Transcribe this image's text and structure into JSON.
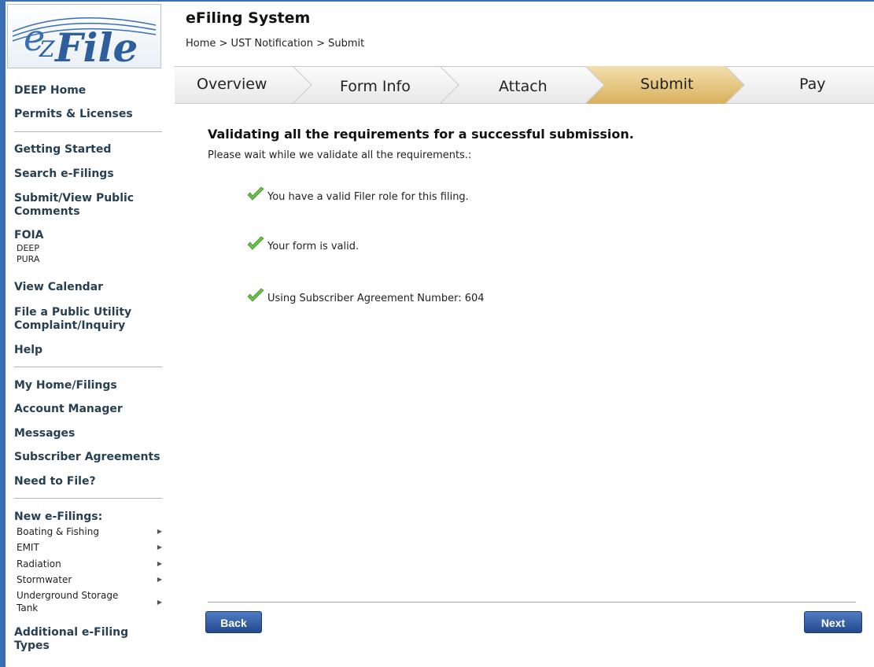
{
  "logo": {
    "text": "eZFile"
  },
  "header": {
    "title": "eFiling System",
    "breadcrumb": "Home > UST Notification > Submit"
  },
  "steps": [
    {
      "label": "Overview",
      "active": false
    },
    {
      "label": "Form Info",
      "active": false
    },
    {
      "label": "Attach",
      "active": false
    },
    {
      "label": "Submit",
      "active": true
    },
    {
      "label": "Pay",
      "active": false
    }
  ],
  "sidebar": {
    "deep_home": "DEEP Home",
    "permits": "Permits & Licenses",
    "getting_started": "Getting Started",
    "search": "Search e-Filings",
    "submit_view_1": "Submit/View Public",
    "submit_view_2": "Comments",
    "foia": "FOIA",
    "foia_deep": "DEEP",
    "foia_pura": "PURA",
    "view_calendar": "View Calendar",
    "file_complaint_1": "File a Public Utility",
    "file_complaint_2": "Complaint/Inquiry",
    "help": "Help",
    "my_home": "My Home/Filings",
    "account_manager": "Account Manager",
    "messages": "Messages",
    "subscriber_agreements": "Subscriber Agreements",
    "need_to_file": "Need to File?",
    "new_efilings": "New e-Filings:",
    "new_items": [
      "Boating & Fishing",
      "EMIT",
      "Radiation",
      "Stormwater",
      "Underground Storage",
      "Tank"
    ],
    "additional_1": "Additional e-Filing",
    "additional_2": "Types"
  },
  "main": {
    "heading": "Validating all the requirements for a successful submission.",
    "subheading": "Please wait while we validate all the requirements.:",
    "checks": [
      "You have a valid Filer role for this filing.",
      "Your form is valid.",
      "Using Subscriber Agreement Number: 604"
    ]
  },
  "buttons": {
    "back": "Back",
    "next": "Next"
  },
  "colors": {
    "accent": "#3b6fb3",
    "active_step": "#e4c47e",
    "button": "#2f5597"
  }
}
